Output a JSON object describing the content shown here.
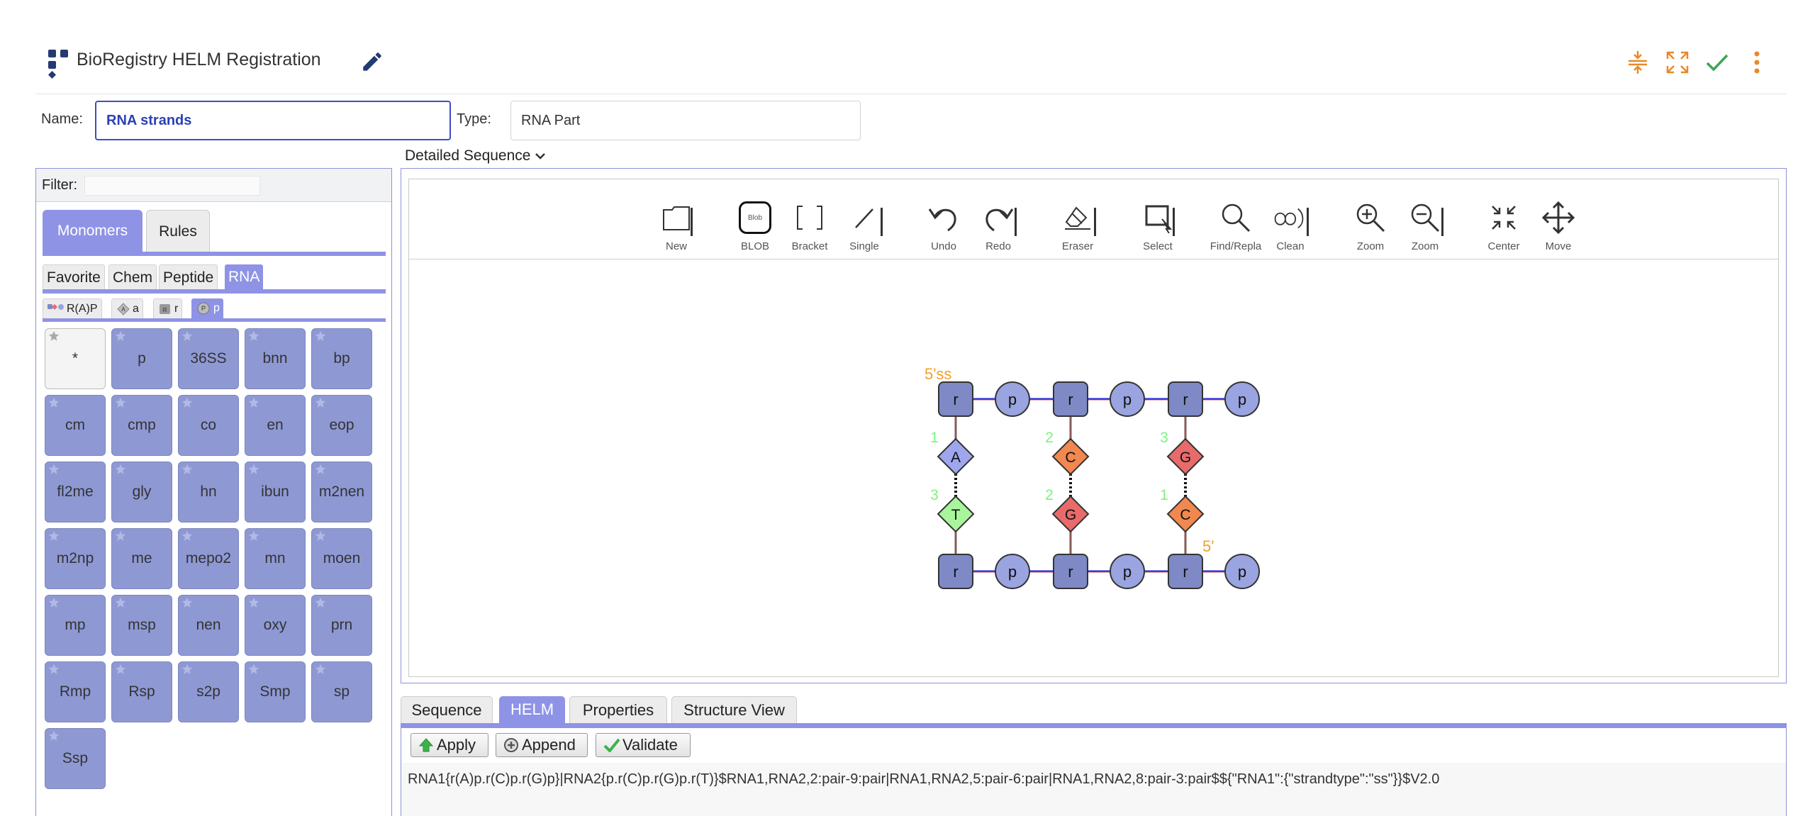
{
  "header": {
    "title": "BioRegistry HELM Registration",
    "icons": [
      "edit-icon",
      "compress-icon",
      "expand-icon",
      "check-icon",
      "more-vert-icon"
    ],
    "accent": "#e8892b",
    "check_color": "#3aa655"
  },
  "form": {
    "name_label": "Name:",
    "name_value": "RNA strands",
    "type_label": "Type:",
    "type_value": "RNA Part"
  },
  "view_select": "Detailed Sequence",
  "palette": {
    "filter_label": "Filter:",
    "main_tabs": [
      "Monomers",
      "Rules"
    ],
    "category_tabs": [
      "Favorite",
      "Chem",
      "Peptide",
      "RNA"
    ],
    "sub_tabs": [
      "R(A)P",
      "a",
      "r",
      "p"
    ],
    "monomers": [
      "*",
      "p",
      "36SS",
      "bnn",
      "bp",
      "cm",
      "cmp",
      "co",
      "en",
      "eop",
      "fl2me",
      "gly",
      "hn",
      "ibun",
      "m2nen",
      "m2np",
      "me",
      "mepo2",
      "mn",
      "moen",
      "mp",
      "msp",
      "nen",
      "oxy",
      "prn",
      "Rmp",
      "Rsp",
      "s2p",
      "Smp",
      "sp",
      "Ssp"
    ],
    "tile_color": "#8e99d4",
    "tab_color": "#8e93e6"
  },
  "toolbar": {
    "tools": [
      "New",
      "BLOB",
      "Bracket",
      "Single",
      "Undo",
      "Redo",
      "Eraser",
      "Select",
      "Find/Repla",
      "Clean",
      "Zoom",
      "Zoom",
      "Center",
      "Move"
    ],
    "blob_text": "Blob"
  },
  "canvas": {
    "strand1_label": "5'ss",
    "strand2_label": "5'",
    "top_backbone": [
      "r",
      "p",
      "r",
      "p",
      "r",
      "p"
    ],
    "bottom_backbone": [
      "r",
      "p",
      "r",
      "p",
      "r",
      "p"
    ],
    "top_bases": [
      "A",
      "C",
      "G"
    ],
    "bottom_bases": [
      "T",
      "G",
      "C"
    ],
    "top_base_numbers": [
      "1",
      "2",
      "3"
    ],
    "bottom_base_numbers": [
      "3",
      "2",
      "1"
    ],
    "colors": {
      "A": "#9ea6ee",
      "C": "#f0884f",
      "G": "#e86a6a",
      "T": "#a8f59c",
      "sugar": "#7e89c6",
      "phosphate": "#9aa4e0",
      "label": "#f0a02a",
      "number": "#7cf27c"
    }
  },
  "bottom_tabs": [
    "Sequence",
    "HELM",
    "Properties",
    "Structure View"
  ],
  "actions": [
    "Apply",
    "Append",
    "Validate"
  ],
  "helm_string": "RNA1{r(A)p.r(C)p.r(G)p}|RNA2{p.r(C)p.r(G)p.r(T)}$RNA1,RNA2,2:pair-9:pair|RNA1,RNA2,5:pair-6:pair|RNA1,RNA2,8:pair-3:pair$${\"RNA1\":{\"strandtype\":\"ss\"}}$V2.0"
}
